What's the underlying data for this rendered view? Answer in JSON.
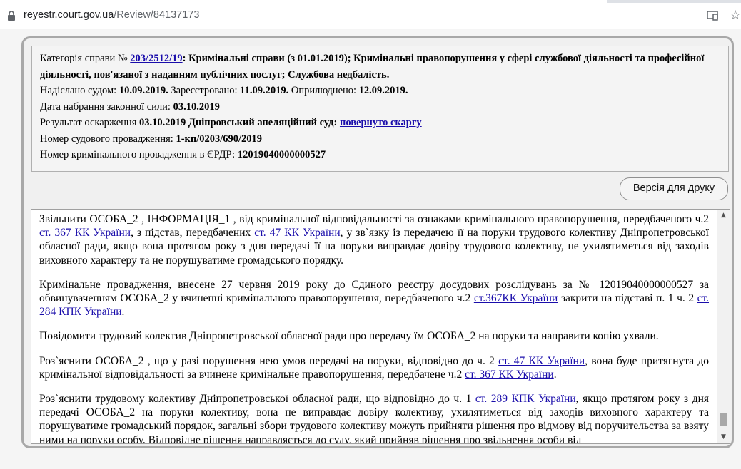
{
  "browser": {
    "url_host": "reyestr.court.gov.ua",
    "url_path": "/Review/84137173"
  },
  "case_info": {
    "category_label": "Категорія справи № ",
    "case_number": "203/2512/19",
    "category_text": ": Кримінальні справи (з 01.01.2019); Кримінальні правопорушення у сфері службової діяльності та професійної діяльності, пов'язаної з наданням публічних послуг; Службова недбалість.",
    "sent_label": "Надіслано судом: ",
    "sent_date": "10.09.2019.",
    "registered_label": " Зареєстровано: ",
    "registered_date": "11.09.2019.",
    "published_label": " Оприлюднено: ",
    "published_date": "12.09.2019.",
    "effective_label": "Дата набрання законної сили: ",
    "effective_date": "03.10.2019",
    "appeal_label": "Результат оскарження ",
    "appeal_text": "03.10.2019 Дніпровський апеляційний суд: ",
    "appeal_link": "повернуто скаргу",
    "proceeding_label": "Номер судового провадження: ",
    "proceeding_number": "1-кп/0203/690/2019",
    "erdr_label": "Номер кримінального провадження в ЄРДР: ",
    "erdr_number": "12019040000000527"
  },
  "print_button": "Версія для друку",
  "document": {
    "p1_a": "Звільнити ОСОБА_2 , ІНФОРМАЦІЯ_1 , від кримінальної відповідальності за ознаками кримінального правопорушення, передбаченого ч.2 ",
    "p1_link1": "ст. 367 КК України",
    "p1_b": ", з підстав, передбачених ",
    "p1_link2": "ст. 47 КК України",
    "p1_c": ", у зв`язку із передачею її на поруки трудового колективу Дніпропетровської обласної ради, якщо вона протягом року з дня передачі її на поруки виправдає довіру трудового колективу, не ухилятиметься від заходів виховного характеру та не порушуватиме громадського порядку.",
    "p2_a": "Кримінальне провадження, внесене 27 червня 2019 року до Єдиного реєстру досудових розслідувань за № 12019040000000527 за обвинуваченням ОСОБА_2 у вчиненні кримінального правопорушення, передбаченого ч.2 ",
    "p2_link1": "ст.367КК України",
    "p2_b": " закрити на підставі п. 1 ч. 2 ",
    "p2_link2": "ст. 284 КПК України",
    "p2_c": ".",
    "p3": "Повідомити трудовий колектив Дніпропетровської обласної ради про передачу їм ОСОБА_2 на поруки та направити копію ухвали.",
    "p4_a": "Роз`яснити ОСОБА_2 , що у разі порушення нею умов передачі на поруки, відповідно до ч. 2 ",
    "p4_link1": "ст. 47 КК України",
    "p4_b": ", вона буде притягнута до кримінальної відповідальності за вчинене кримінальне правопорушення, передбачене ч.2 ",
    "p4_link2": "ст. 367 КК України",
    "p4_c": ".",
    "p5_a": "Роз`яснити трудовому колективу Дніпропетровської обласної ради, що відповідно до ч. 1 ",
    "p5_link1": "ст. 289 КПК України",
    "p5_b": ", якщо протягом року з дня передачі ОСОБА_2 на поруки колективу, вона не виправдає довіру колективу, ухилятиметься від заходів виховного характеру та порушуватиме громадський порядок, загальні збори трудового колективу можуть прийняти рішення про відмову від поручительства за взяту ними на поруки особу. Відповідне рішення направляється до суду, який прийняв рішення про звільнення особи від"
  }
}
